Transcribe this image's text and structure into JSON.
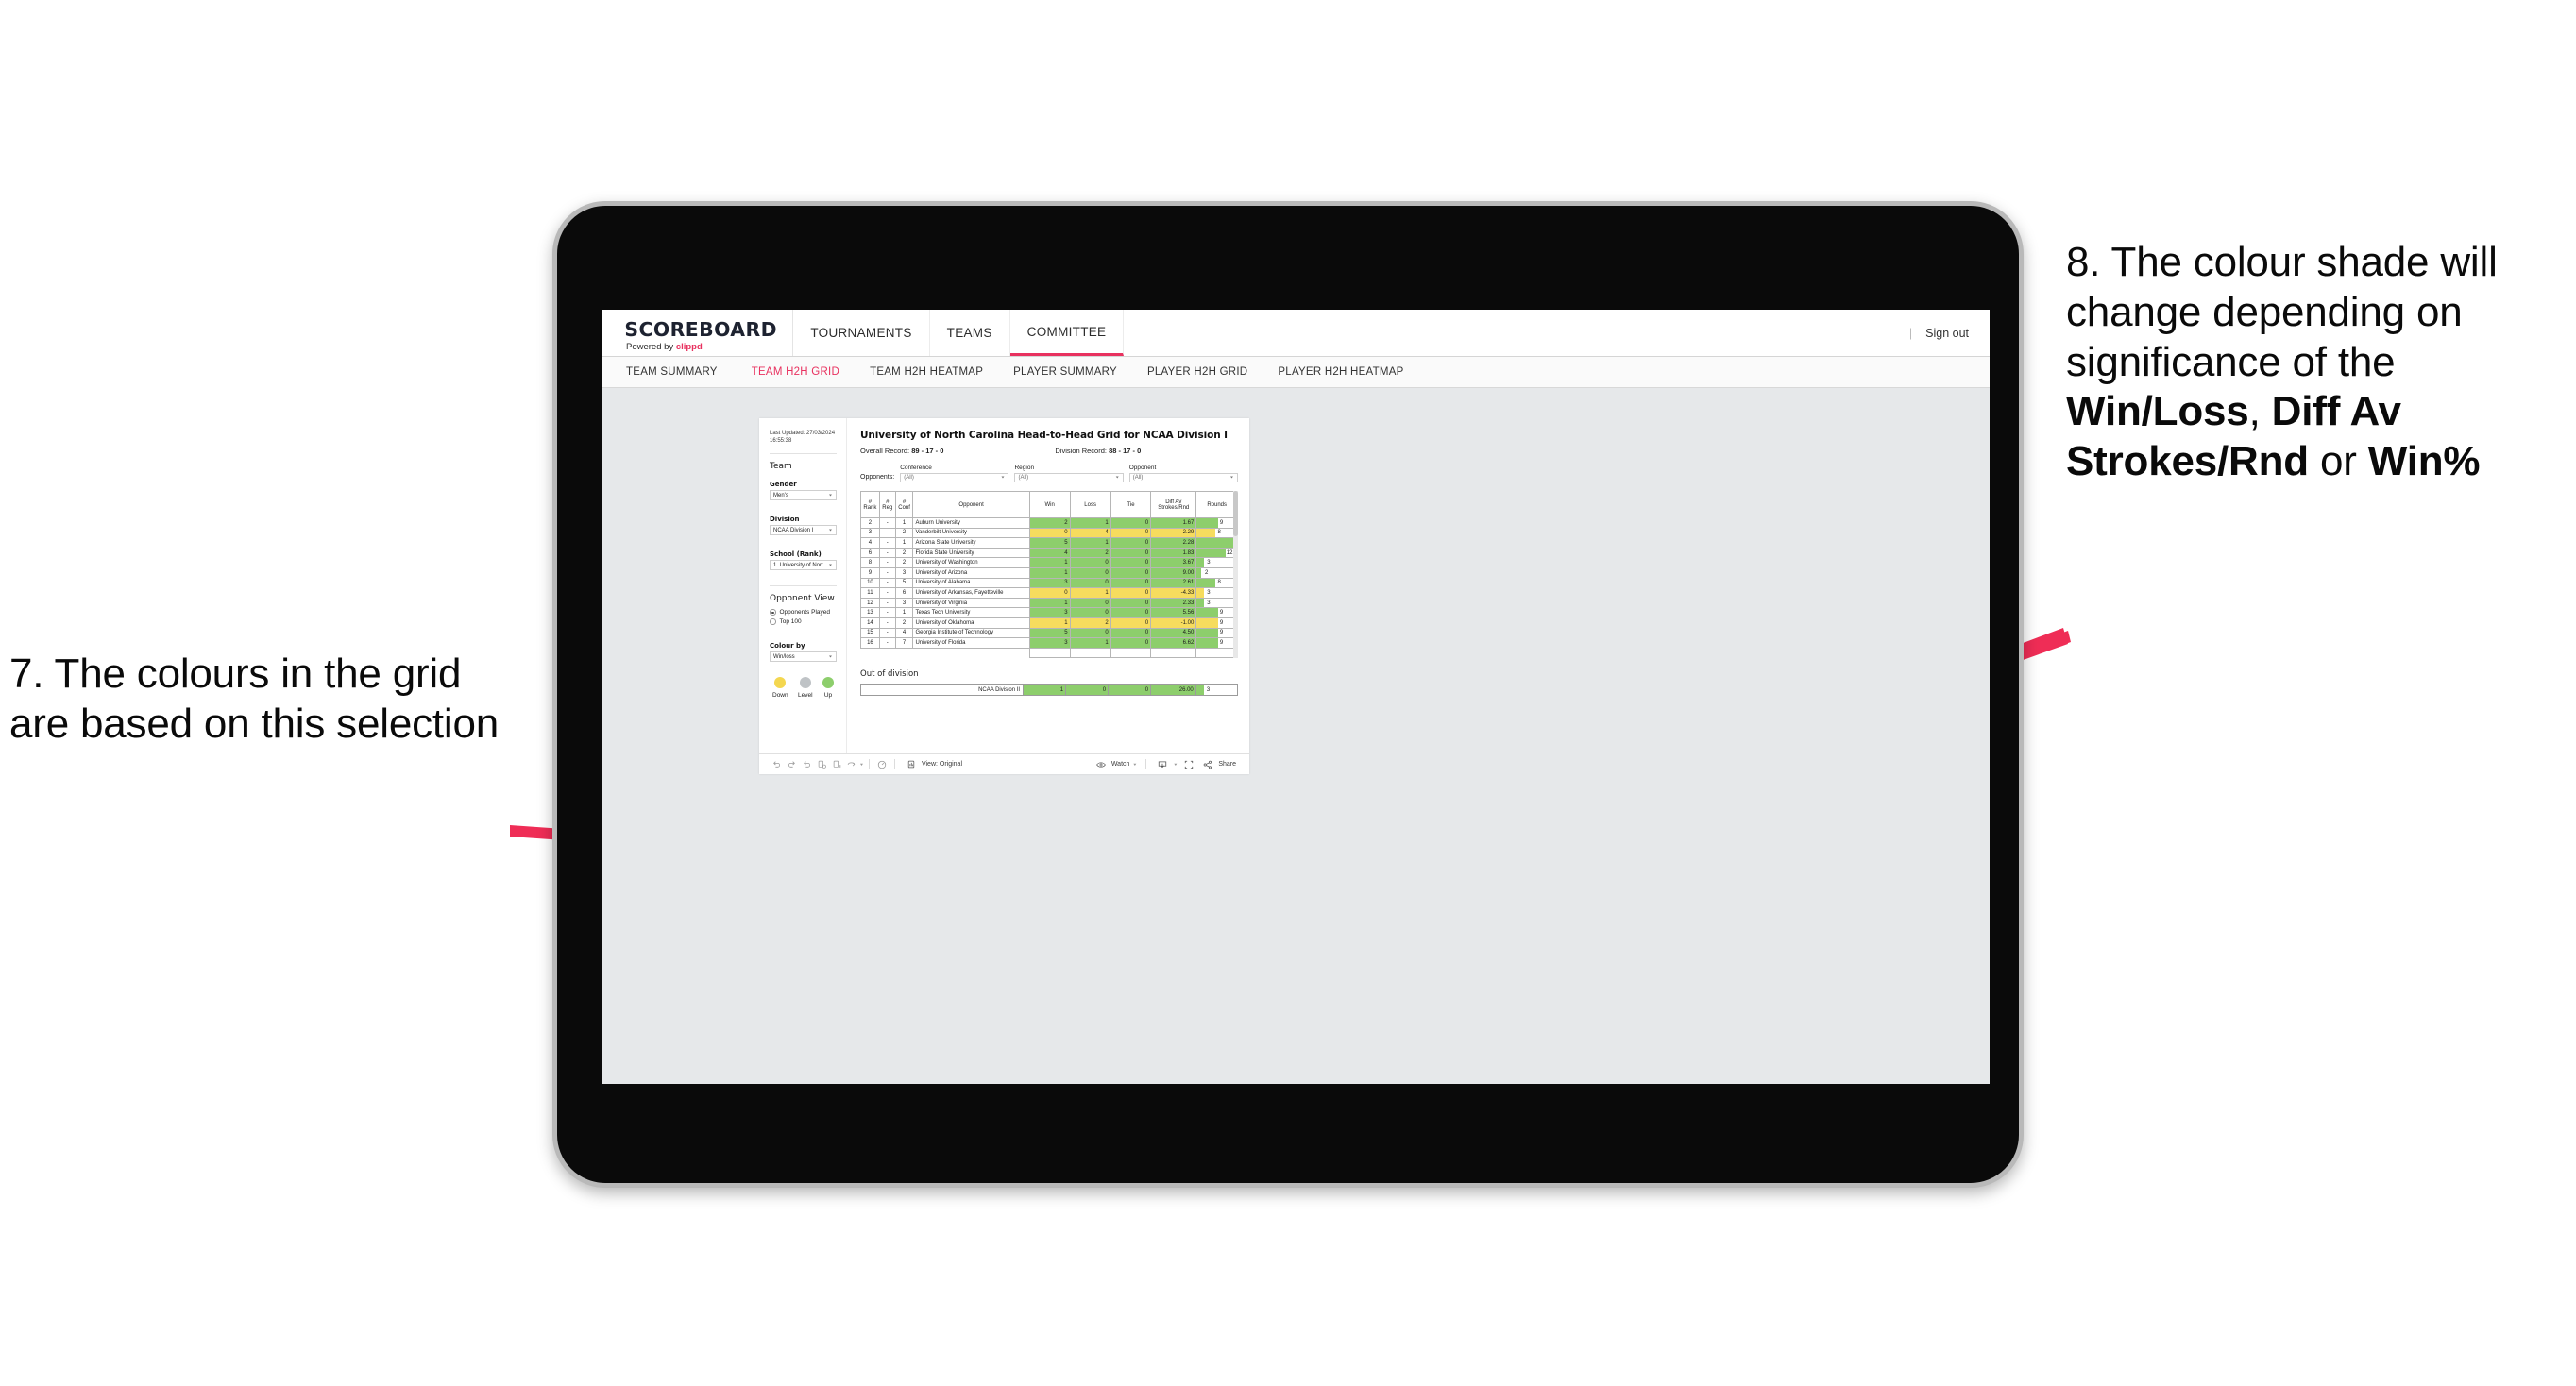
{
  "annotations": {
    "left": {
      "number": "7.",
      "text": "The colours in the grid are based on this selection",
      "full": "7. The colours in the grid are based on this selection"
    },
    "right": {
      "number": "8.",
      "lead": "8. The colour shade will change depending on significance of the ",
      "bold1": "Win/Loss",
      "mid1": ", ",
      "bold2": "Diff Av Strokes/Rnd",
      "mid2": " or ",
      "bold3": "Win%"
    },
    "arrow_color": "#ef2d56"
  },
  "app": {
    "brand": {
      "title": "SCOREBOARD",
      "powered_prefix": "Powered by ",
      "powered_name": "clippd"
    },
    "topnav": [
      {
        "label": "TOURNAMENTS",
        "active": false
      },
      {
        "label": "TEAMS",
        "active": false
      },
      {
        "label": "COMMITTEE",
        "active": true
      }
    ],
    "signout": {
      "divider": "|",
      "label": "Sign out"
    },
    "subnav": [
      {
        "label": "TEAM SUMMARY",
        "active": false
      },
      {
        "label": "TEAM H2H GRID",
        "active": true
      },
      {
        "label": "TEAM H2H HEATMAP",
        "active": false
      },
      {
        "label": "PLAYER SUMMARY",
        "active": false
      },
      {
        "label": "PLAYER H2H GRID",
        "active": false
      },
      {
        "label": "PLAYER H2H HEATMAP",
        "active": false
      }
    ],
    "accent": "#e8315f"
  },
  "panel": {
    "last_updated": "Last Updated: 27/03/2024 16:55:38",
    "section_team": "Team",
    "gender": {
      "label": "Gender",
      "value": "Men's"
    },
    "division": {
      "label": "Division",
      "value": "NCAA Division I"
    },
    "school": {
      "label": "School (Rank)",
      "value": "1. University of Nort..."
    },
    "opponent_view": {
      "heading": "Opponent View",
      "options": [
        {
          "label": "Opponents Played",
          "selected": true
        },
        {
          "label": "Top 100",
          "selected": false
        }
      ]
    },
    "colour_by": {
      "label": "Colour by",
      "value": "Win/loss"
    },
    "legend": [
      {
        "caption": "Down",
        "color": "#f4d750"
      },
      {
        "caption": "Level",
        "color": "#bfc3c6"
      },
      {
        "caption": "Up",
        "color": "#8dce6c"
      }
    ]
  },
  "content": {
    "title": "University of North Carolina Head-to-Head Grid for NCAA Division I",
    "overall_record_label": "Overall Record: ",
    "overall_record_value": "89 - 17 - 0",
    "division_record_label": "Division Record: ",
    "division_record_value": "88 - 17 - 0",
    "opponents_label": "Opponents:",
    "filters": [
      {
        "label": "Conference",
        "value": "(All)"
      },
      {
        "label": "Region",
        "value": "(All)"
      },
      {
        "label": "Opponent",
        "value": "(All)"
      }
    ],
    "out_of_division_title": "Out of division"
  },
  "chart_data": {
    "type": "table",
    "title": "University of North Carolina Head-to-Head Grid for NCAA Division I",
    "columns": [
      "# Rank",
      "# Reg",
      "# Conf",
      "Opponent",
      "Win",
      "Loss",
      "Tie",
      "Diff Av Strokes/Rnd",
      "Rounds"
    ],
    "header_lines": [
      [
        "#",
        "Rank"
      ],
      [
        "#",
        "Reg"
      ],
      [
        "#",
        "Conf"
      ],
      [
        "Opponent",
        ""
      ],
      [
        "Win",
        ""
      ],
      [
        "Loss",
        ""
      ],
      [
        "Tie",
        ""
      ],
      [
        "Diff Av",
        "Strokes/Rnd"
      ],
      [
        "Rounds",
        ""
      ]
    ],
    "rounds_max": 17,
    "colors": {
      "up": "#8dce6c",
      "down": "#f6dc5e",
      "level": "#bfc3c6"
    },
    "rows": [
      {
        "rank": "2",
        "reg": "-",
        "conf": "1",
        "opponent": "Auburn University",
        "win": "2",
        "loss": "1",
        "tie": "0",
        "diff": "1.67",
        "rounds": "9",
        "rounds_num": 9,
        "state": "up"
      },
      {
        "rank": "3",
        "reg": "-",
        "conf": "2",
        "opponent": "Vanderbilt University",
        "win": "0",
        "loss": "4",
        "tie": "0",
        "diff": "-2.29",
        "rounds": "8",
        "rounds_num": 8,
        "state": "down"
      },
      {
        "rank": "4",
        "reg": "-",
        "conf": "1",
        "opponent": "Arizona State University",
        "win": "5",
        "loss": "1",
        "tie": "0",
        "diff": "2.28",
        "rounds": "17",
        "rounds_num": 17,
        "state": "up"
      },
      {
        "rank": "6",
        "reg": "-",
        "conf": "2",
        "opponent": "Florida State University",
        "win": "4",
        "loss": "2",
        "tie": "0",
        "diff": "1.83",
        "rounds": "12",
        "rounds_num": 12,
        "state": "up"
      },
      {
        "rank": "8",
        "reg": "-",
        "conf": "2",
        "opponent": "University of Washington",
        "win": "1",
        "loss": "0",
        "tie": "0",
        "diff": "3.67",
        "rounds": "3",
        "rounds_num": 3,
        "state": "up"
      },
      {
        "rank": "9",
        "reg": "-",
        "conf": "3",
        "opponent": "University of Arizona",
        "win": "1",
        "loss": "0",
        "tie": "0",
        "diff": "9.00",
        "rounds": "2",
        "rounds_num": 2,
        "state": "up"
      },
      {
        "rank": "10",
        "reg": "-",
        "conf": "5",
        "opponent": "University of Alabama",
        "win": "3",
        "loss": "0",
        "tie": "0",
        "diff": "2.61",
        "rounds": "8",
        "rounds_num": 8,
        "state": "up"
      },
      {
        "rank": "11",
        "reg": "-",
        "conf": "6",
        "opponent": "University of Arkansas, Fayetteville",
        "win": "0",
        "loss": "1",
        "tie": "0",
        "diff": "-4.33",
        "rounds": "3",
        "rounds_num": 3,
        "state": "down"
      },
      {
        "rank": "12",
        "reg": "-",
        "conf": "3",
        "opponent": "University of Virginia",
        "win": "1",
        "loss": "0",
        "tie": "0",
        "diff": "2.33",
        "rounds": "3",
        "rounds_num": 3,
        "state": "up"
      },
      {
        "rank": "13",
        "reg": "-",
        "conf": "1",
        "opponent": "Texas Tech University",
        "win": "3",
        "loss": "0",
        "tie": "0",
        "diff": "5.56",
        "rounds": "9",
        "rounds_num": 9,
        "state": "up"
      },
      {
        "rank": "14",
        "reg": "-",
        "conf": "2",
        "opponent": "University of Oklahoma",
        "win": "1",
        "loss": "2",
        "tie": "0",
        "diff": "-1.00",
        "rounds": "9",
        "rounds_num": 9,
        "state": "down"
      },
      {
        "rank": "15",
        "reg": "-",
        "conf": "4",
        "opponent": "Georgia Institute of Technology",
        "win": "5",
        "loss": "0",
        "tie": "0",
        "diff": "4.50",
        "rounds": "9",
        "rounds_num": 9,
        "state": "up"
      },
      {
        "rank": "16",
        "reg": "-",
        "conf": "7",
        "opponent": "University of Florida",
        "win": "3",
        "loss": "1",
        "tie": "0",
        "diff": "6.62",
        "rounds": "9",
        "rounds_num": 9,
        "state": "up"
      }
    ],
    "out_of_division": {
      "label": "NCAA Division II",
      "win": "1",
      "loss": "0",
      "tie": "0",
      "diff": "26.00",
      "rounds": "3",
      "rounds_num": 3,
      "state": "up"
    }
  },
  "toolbar": {
    "view_label": "View: Original",
    "watch_label": "Watch",
    "share_label": "Share"
  }
}
